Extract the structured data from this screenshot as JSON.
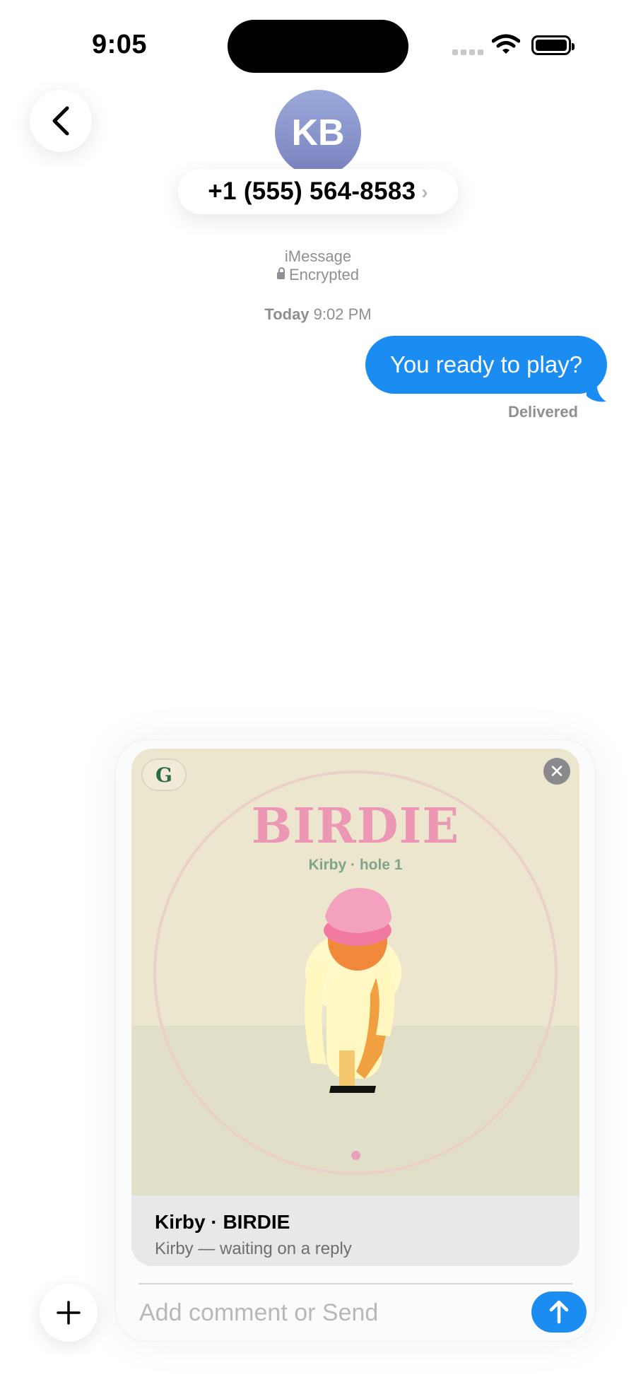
{
  "status_bar": {
    "time": "9:05"
  },
  "header": {
    "avatar_initials": "KB",
    "contact": "+1 (555) 564-8583",
    "contact_chevron": "›"
  },
  "service": {
    "name": "iMessage",
    "encryption": "Encrypted"
  },
  "conversation": {
    "timestamp_day": "Today",
    "timestamp_time": "9:02 PM",
    "messages": [
      {
        "text": "You ready to play?",
        "direction": "outgoing",
        "status": "Delivered"
      }
    ]
  },
  "attachment": {
    "app_logo": "G",
    "close_glyph": "✕",
    "headline": "BIRDIE",
    "subline": "Kirby · hole 1",
    "caption_title": "Kirby · BIRDIE",
    "caption_subtitle": "Kirby — waiting on a reply",
    "colors": {
      "headline": "#ec97b3",
      "subline": "#7ea588",
      "background": "#ede6cf"
    }
  },
  "composer": {
    "placeholder": "Add comment or Send"
  },
  "colors": {
    "accent": "#1b8cf2"
  },
  "icons": [
    "back-chevron-icon",
    "wifi-icon",
    "battery-icon",
    "cellular-signal-icon",
    "lock-icon",
    "close-icon",
    "send-arrow-icon",
    "plus-icon"
  ]
}
